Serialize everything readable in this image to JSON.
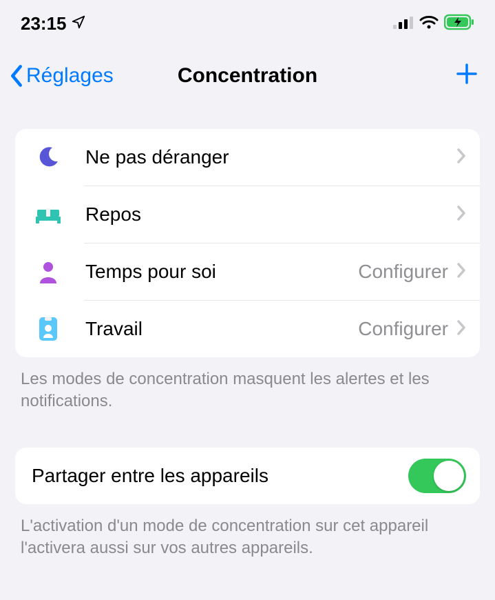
{
  "status": {
    "time": "23:15"
  },
  "nav": {
    "back_label": "Réglages",
    "title": "Concentration"
  },
  "focus_modes": [
    {
      "icon": "moon",
      "label": "Ne pas déranger",
      "detail": ""
    },
    {
      "icon": "bed",
      "label": "Repos",
      "detail": ""
    },
    {
      "icon": "person",
      "label": "Temps pour soi",
      "detail": "Configurer"
    },
    {
      "icon": "badge",
      "label": "Travail",
      "detail": "Configurer"
    }
  ],
  "focus_footer": "Les modes de concentration masquent les alertes et les notifications.",
  "share": {
    "label": "Partager entre les appareils",
    "footer": "L'activation d'un mode de concentration sur cet appareil l'activera aussi sur vos autres appareils.",
    "on": true
  }
}
